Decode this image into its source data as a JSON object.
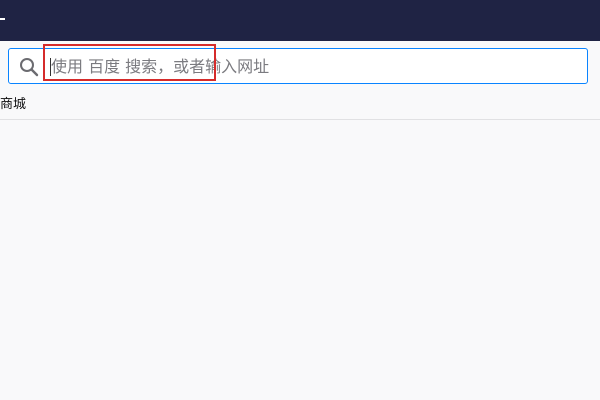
{
  "urlbar": {
    "placeholder": "使用 百度 搜索，或者输入网址",
    "value": "",
    "search_icon": "magnifier-icon"
  },
  "bookmarks": {
    "items": [
      {
        "label": "商城"
      }
    ]
  },
  "colors": {
    "titlebar": "#1f2344",
    "focus_border": "#0a84ff",
    "highlight_box": "#d52b2b",
    "page_background": "#f9f9fa"
  }
}
